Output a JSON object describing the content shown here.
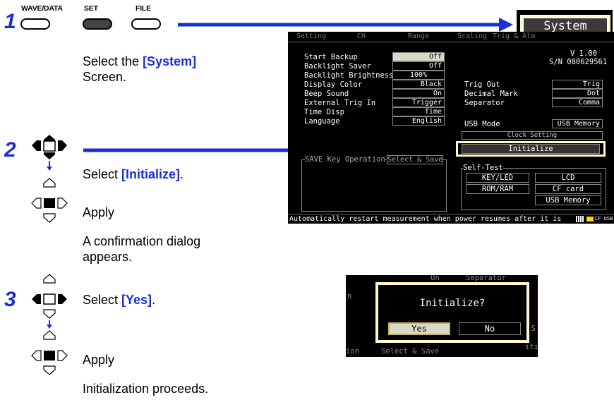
{
  "step1": {
    "num": "1",
    "keys": [
      "WAVE/DATA",
      "SET",
      "FILE"
    ],
    "line1_pre": "Select the ",
    "line1_target": "[System]",
    "line2": "Screen."
  },
  "step2": {
    "num": "2",
    "select_pre": "Select ",
    "select_target": "[Initialize]",
    "select_post": ".",
    "apply": "Apply",
    "note1": "A  confirmation  dialog",
    "note2": "appears."
  },
  "step3": {
    "num": "3",
    "select_pre": "Select ",
    "select_target": "[Yes]",
    "select_post": ".",
    "apply": "Apply",
    "result": "Initialization proceeds."
  },
  "system_tab": "System",
  "screen": {
    "tabs": [
      "Setting",
      "CH",
      "Range",
      "Scaling",
      "Trig & Alm"
    ],
    "version": "V 1.00",
    "serial": "S/N 080629561",
    "left_rows": [
      {
        "label": "Start Backup",
        "value": "Off"
      },
      {
        "label": "Backlight Saver",
        "value": "Off"
      },
      {
        "label": "Backlight Brightness",
        "value": "100%"
      },
      {
        "label": "Display Color",
        "value": "Black"
      },
      {
        "label": "Beep Sound",
        "value": "On"
      },
      {
        "label": "External Trig In",
        "value": "Trigger"
      },
      {
        "label": "Time Disp",
        "value": "Time"
      },
      {
        "label": "Language",
        "value": "English"
      }
    ],
    "right_rows": [
      {
        "label": "Trig Out",
        "value": "Trig"
      },
      {
        "label": "Decimal Mark",
        "value": "Dot"
      },
      {
        "label": "Separator",
        "value": "Comma"
      }
    ],
    "usb_mode_label": "USB Mode",
    "usb_mode_value": "USB Memory",
    "clock_setting": "Clock Setting",
    "initialize": "Initialize",
    "save_key_label": "SAVE Key Operation",
    "save_key_value": "Select & Save",
    "self_test_label": "Self-Test",
    "self_test_buttons": [
      "KEY/LED",
      "LCD",
      "ROM/RAM",
      "CF card",
      "USB Memory"
    ],
    "status": "Automatically restart measurement when power resumes after it is",
    "status_icons": "CF USB"
  },
  "dialog": {
    "bg_on": "On",
    "bg_separator": "Separator",
    "bg_n": "n",
    "bg_k": "k S",
    "bg_ion": "ion",
    "bg_select_save": "Select & Save",
    "bg_itia": "itia",
    "title": "Initialize?",
    "yes": "Yes",
    "no": "No"
  }
}
